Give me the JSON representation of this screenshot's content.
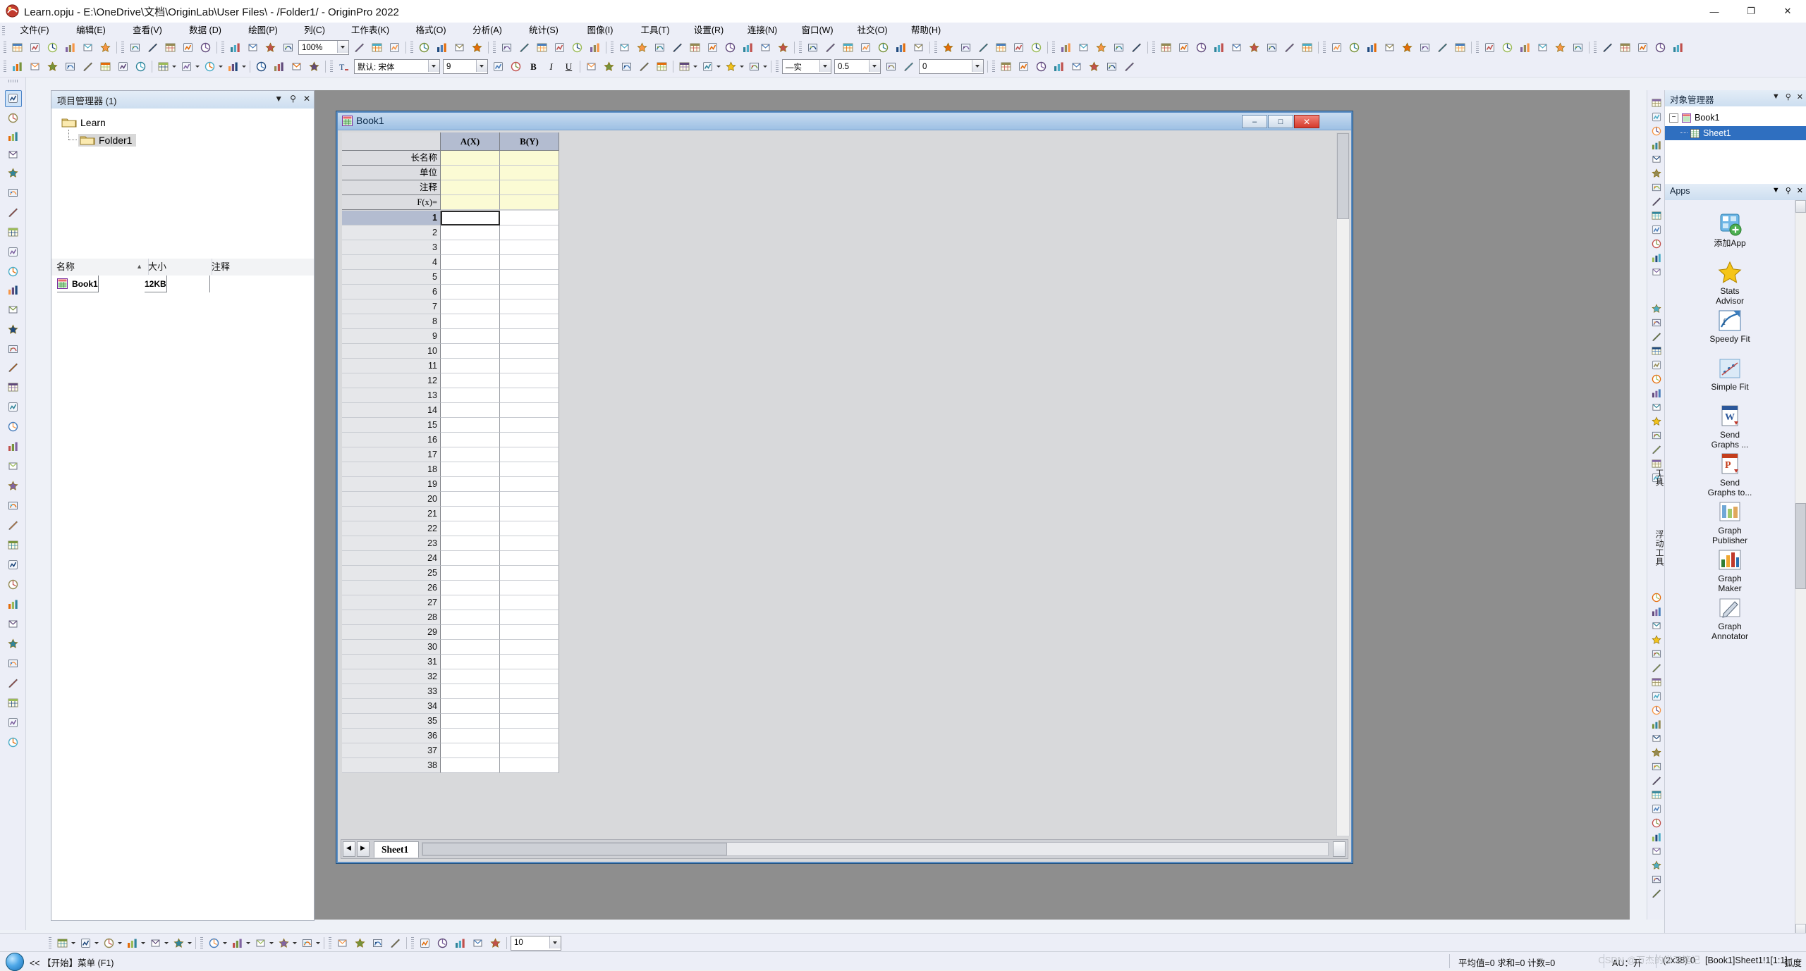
{
  "window": {
    "title": "Learn.opju - E:\\OneDrive\\文档\\OriginLab\\User Files\\ - /Folder1/ - OriginPro 2022",
    "app_icon": "origin-logo-icon",
    "minimize": "—",
    "maximize": "❐",
    "close": "✕"
  },
  "menu": {
    "items": [
      {
        "label": "文件(F)",
        "name": "menu-file"
      },
      {
        "label": "编辑(E)",
        "name": "menu-edit"
      },
      {
        "label": "查看(V)",
        "name": "menu-view"
      },
      {
        "label": "数据 (D)",
        "name": "menu-data"
      },
      {
        "label": "绘图(P)",
        "name": "menu-plot"
      },
      {
        "label": "列(C)",
        "name": "menu-column"
      },
      {
        "label": "工作表(K)",
        "name": "menu-worksheet"
      },
      {
        "label": "格式(O)",
        "name": "menu-format"
      },
      {
        "label": "分析(A)",
        "name": "menu-analysis"
      },
      {
        "label": "统计(S)",
        "name": "menu-statistics"
      },
      {
        "label": "图像(I)",
        "name": "menu-image"
      },
      {
        "label": "工具(T)",
        "name": "menu-tools"
      },
      {
        "label": "设置(R)",
        "name": "menu-preferences"
      },
      {
        "label": "连接(N)",
        "name": "menu-connectivity"
      },
      {
        "label": "窗口(W)",
        "name": "menu-window"
      },
      {
        "label": "社交(O)",
        "name": "menu-social"
      },
      {
        "label": "帮助(H)",
        "name": "menu-help"
      }
    ]
  },
  "toolbar_row1": {
    "zoom_value": "100%"
  },
  "toolbar_row2": {
    "font_label": "默认: 宋体",
    "font_size": "9",
    "bold": "B",
    "italic": "I",
    "underline": "U",
    "line_style": "—实",
    "line_width": "0.5",
    "transparency": "0"
  },
  "project_explorer": {
    "title": "项目管理器 (1)",
    "dropdown_icon": "chevron-down-icon",
    "pin_icon": "pin-icon",
    "close_icon": "close-icon",
    "tree": [
      {
        "label": "Learn",
        "name": "tree-node-learn",
        "icon": "folder-icon",
        "selected": false
      },
      {
        "label": "Folder1",
        "name": "tree-node-folder1",
        "icon": "folder-icon",
        "selected": true
      }
    ],
    "columns": [
      {
        "label": "名称",
        "name": "col-name",
        "sort": "▲"
      },
      {
        "label": "大小",
        "name": "col-size"
      },
      {
        "label": "注释",
        "name": "col-comment"
      }
    ],
    "rows": [
      {
        "name": "Book1",
        "size": "12KB",
        "comment": "",
        "icon": "workbook-icon"
      }
    ]
  },
  "workbook": {
    "title": "Book1",
    "icon": "workbook-icon",
    "minimize": "–",
    "maximize": "□",
    "close": "✕",
    "header_labels": [
      "长名称",
      "单位",
      "注释",
      "F(x)="
    ],
    "columns": [
      {
        "label": "A(X)",
        "name": "column-header-a"
      },
      {
        "label": "B(Y)",
        "name": "column-header-b"
      }
    ],
    "row_numbers": [
      1,
      2,
      3,
      4,
      5,
      6,
      7,
      8,
      9,
      10,
      11,
      12,
      13,
      14,
      15,
      16,
      17,
      18,
      19,
      20,
      21,
      22,
      23,
      24,
      25,
      26,
      27,
      28,
      29,
      30,
      31,
      32,
      33,
      34,
      35,
      36,
      37,
      38
    ],
    "active_row": 1,
    "sheet_tab": "Sheet1",
    "nav_first": "◀",
    "nav_last": "▶"
  },
  "object_manager": {
    "title": "对象管理器",
    "dropdown_icon": "chevron-down-icon",
    "pin_icon": "pin-icon",
    "close_icon": "close-icon",
    "tree": [
      {
        "label": "Book1",
        "name": "obj-book1",
        "selected": false
      },
      {
        "label": "Sheet1",
        "name": "obj-sheet1",
        "selected": true
      }
    ]
  },
  "apps_panel": {
    "title": "Apps",
    "dropdown_icon": "chevron-down-icon",
    "pin_icon": "pin-icon",
    "close_icon": "close-icon",
    "items": [
      {
        "label": "添加App",
        "name": "app-add-app",
        "icon": "add-app-icon"
      },
      {
        "label": "Stats\nAdvisor",
        "name": "app-stats-advisor",
        "icon": "star-icon"
      },
      {
        "label": "Speedy Fit",
        "name": "app-speedy-fit",
        "icon": "speedy-fit-icon"
      },
      {
        "label": "Simple Fit",
        "name": "app-simple-fit",
        "icon": "simple-fit-icon"
      },
      {
        "label": "Send\nGraphs ...",
        "name": "app-send-graphs-word",
        "icon": "word-icon"
      },
      {
        "label": "Send\nGraphs to...",
        "name": "app-send-graphs-ppt",
        "icon": "powerpoint-icon"
      },
      {
        "label": "Graph\nPublisher",
        "name": "app-graph-publisher",
        "icon": "graph-publisher-icon"
      },
      {
        "label": "Graph\nMaker",
        "name": "app-graph-maker",
        "icon": "graph-maker-icon"
      },
      {
        "label": "Graph\nAnnotator",
        "name": "app-graph-annotator",
        "icon": "pencil-icon"
      }
    ]
  },
  "right_dock_labels": {
    "top": "工具",
    "bottom": "浮动工具"
  },
  "status_bar": {
    "hint": "<< 【开始】菜单 (F1)",
    "stats": "平均值=0 求和=0 计数=0",
    "au": "AU：开",
    "dims": "(2x38) 0",
    "location": "[Book1]Sheet1!1[1:1]",
    "angle": "弧度",
    "watermark": "CSDN @万杰的学习笔记"
  }
}
